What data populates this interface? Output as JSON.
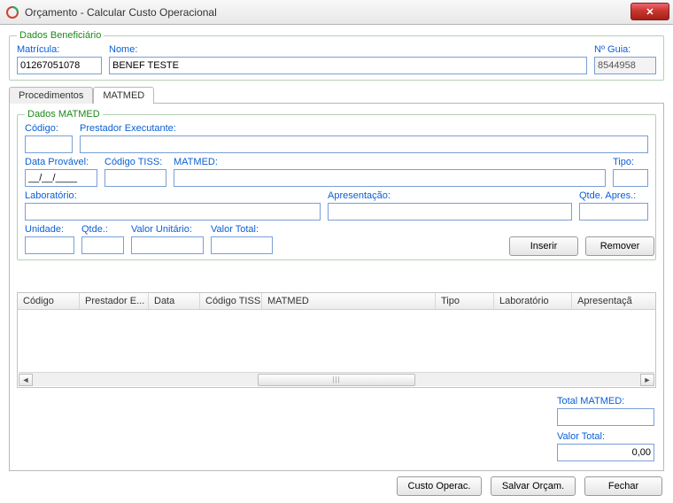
{
  "window": {
    "title": "Orçamento - Calcular Custo Operacional",
    "close_glyph": "✕"
  },
  "benef": {
    "legend": "Dados Beneficiário",
    "matricula_label": "Matrícula:",
    "matricula_value": "01267051078",
    "nome_label": "Nome:",
    "nome_value": "BENEF TESTE",
    "guia_label": "Nº Guia:",
    "guia_value": "8544958"
  },
  "tabs": {
    "procedimentos": "Procedimentos",
    "matmed": "MATMED",
    "active": "matmed"
  },
  "matmed": {
    "legend": "Dados MATMED",
    "codigo_label": "Código:",
    "codigo_value": "",
    "prestador_label": "Prestador Executante:",
    "prestador_value": "",
    "dataprov_label": "Data Provável:",
    "dataprov_value": "__/__/____",
    "ctiss_label": "Código TISS:",
    "ctiss_value": "",
    "matmed_label": "MATMED:",
    "matmed_value": "",
    "tipo_label": "Tipo:",
    "tipo_value": "",
    "lab_label": "Laboratório:",
    "lab_value": "",
    "apres_label": "Apresentação:",
    "apres_value": "",
    "qapres_label": "Qtde. Apres.:",
    "qapres_value": "",
    "unid_label": "Unidade:",
    "unid_value": "",
    "qtde_label": "Qtde.:",
    "qtde_value": "",
    "vu_label": "Valor Unitário:",
    "vu_value": "",
    "vt_label": "Valor Total:",
    "vt_value": ""
  },
  "buttons": {
    "inserir": "Inserir",
    "remover": "Remover",
    "custo_operac": "Custo Operac.",
    "salvar_orcam": "Salvar Orçam.",
    "fechar": "Fechar"
  },
  "grid": {
    "columns": [
      "Código",
      "Prestador E...",
      "Data",
      "Código TISS",
      "MATMED",
      "Tipo",
      "Laboratório",
      "Apresentaçã"
    ],
    "rows": []
  },
  "totals": {
    "total_matmed_label": "Total MATMED:",
    "total_matmed_value": "",
    "valor_total_label": "Valor Total:",
    "valor_total_value": "0,00"
  }
}
